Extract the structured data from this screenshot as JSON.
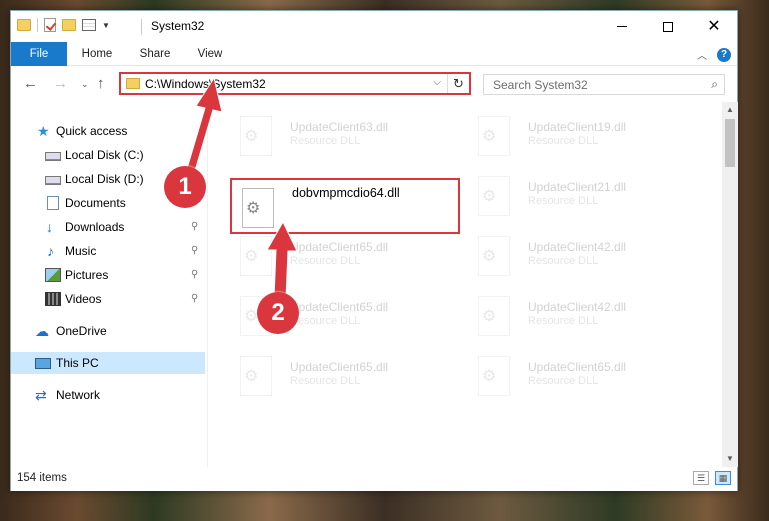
{
  "window": {
    "title": "System32",
    "controls": {
      "minimize": "",
      "maximize": "",
      "close": "✕"
    }
  },
  "ribbon": {
    "tabs": [
      "File",
      "Home",
      "Share",
      "View"
    ],
    "collapse_icon": "chevron-up-icon",
    "help_label": "?"
  },
  "address": {
    "path": "C:\\Windows\\System32",
    "dropdown": "⌵",
    "refresh": "↻"
  },
  "search": {
    "placeholder": "Search System32",
    "icon": "⌕"
  },
  "nav": {
    "back": "←",
    "forward": "→",
    "recent": "⌄",
    "up": "↑",
    "items": [
      {
        "label": "Quick access",
        "icon": "star-icon",
        "glyph": "★",
        "pinned": false
      },
      {
        "label": "Local Disk (C:)",
        "icon": "drive-icon",
        "glyph": "",
        "pinned": false
      },
      {
        "label": "Local Disk (D:)",
        "icon": "drive-icon",
        "glyph": "",
        "pinned": false
      },
      {
        "label": "Documents",
        "icon": "documents-icon",
        "glyph": "",
        "pinned": false
      },
      {
        "label": "Downloads",
        "icon": "download-arrow-icon",
        "glyph": "↓",
        "pinned": true
      },
      {
        "label": "Music",
        "icon": "music-note-icon",
        "glyph": "♪",
        "pinned": true
      },
      {
        "label": "Pictures",
        "icon": "pictures-icon",
        "glyph": "",
        "pinned": true
      },
      {
        "label": "Videos",
        "icon": "film-icon",
        "glyph": "",
        "pinned": true
      },
      {
        "label": "OneDrive",
        "icon": "cloud-icon",
        "glyph": "☁",
        "pinned": false
      },
      {
        "label": "This PC",
        "icon": "computer-icon",
        "glyph": "",
        "pinned": false,
        "selected": true
      },
      {
        "label": "Network",
        "icon": "network-icon",
        "glyph": "⇄",
        "pinned": false
      }
    ],
    "pin_glyph": "📌"
  },
  "files": {
    "highlighted": {
      "name": "dobvmpmcdio64.dll",
      "type": ""
    },
    "left_column": [
      {
        "name": "UpdateClient63.dll",
        "type": "Resource DLL"
      },
      {
        "name": "UpdateClient65.dll",
        "type": "Resource DLL"
      },
      {
        "name": "UpdateClient65.dll",
        "type": "Resource DLL"
      },
      {
        "name": "UpdateClient65.dll",
        "type": "Resource DLL"
      }
    ],
    "right_column": [
      {
        "name": "UpdateClient19.dll",
        "type": "Resource DLL"
      },
      {
        "name": "UpdateClient21.dll",
        "type": "Resource DLL"
      },
      {
        "name": "UpdateClient42.dll",
        "type": "Resource DLL"
      },
      {
        "name": "UpdateClient42.dll",
        "type": "Resource DLL"
      },
      {
        "name": "UpdateClient65.dll",
        "type": "Resource DLL"
      }
    ],
    "gear_glyph": "⚙"
  },
  "status": {
    "item_count": "154 items",
    "details_view": "☰",
    "tiles_view": "▦"
  },
  "annotations": {
    "step1": "1",
    "step2": "2"
  },
  "colors": {
    "accent": "#1979ca",
    "highlight_red": "#d9363e",
    "selected_bg": "#cce8ff"
  }
}
